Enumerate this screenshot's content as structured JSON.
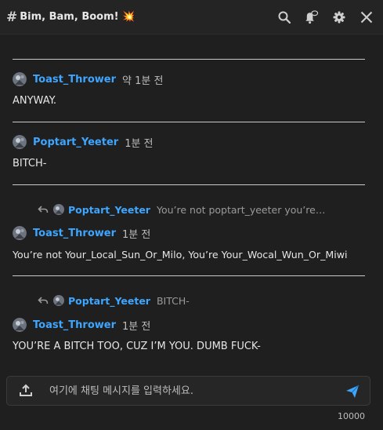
{
  "header": {
    "hash": "#",
    "title": "Bim, Bam, Boom! 💥",
    "icons": [
      "search-icon",
      "bell-icon",
      "gear-icon",
      "close-icon"
    ]
  },
  "messages": [
    {
      "author": "Toast_Thrower",
      "time": "약 1분 전",
      "text": "ANYWAY."
    },
    {
      "author": "Poptart_Yeeter",
      "time": "1분 전",
      "text": "BITCH-"
    },
    {
      "reply": {
        "author": "Poptart_Yeeter",
        "snippet": "You’re not poptart_yeeter you’re…"
      },
      "author": "Toast_Thrower",
      "time": "1분 전",
      "text": "You’re not Your_Local_Sun_Or_Milo, You’re Your_Wocal_Wun_Or_Miwi"
    },
    {
      "reply": {
        "author": "Poptart_Yeeter",
        "snippet": "BITCH-"
      },
      "author": "Toast_Thrower",
      "time": "1분 전",
      "text": "YOU’RE A BITCH TOO, CUZ I’M YOU. DUMB FUCK-"
    }
  ],
  "composer": {
    "placeholder": "여기에 채팅 메시지를 입력하세요.",
    "value": "",
    "char_limit": "10000"
  },
  "colors": {
    "accent": "#3ea6ff",
    "background": "#1f1f1f"
  }
}
